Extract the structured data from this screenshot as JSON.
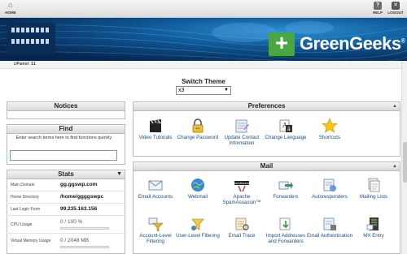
{
  "topbar": {
    "home_label": "HOME",
    "help_label": "HELP",
    "logout_label": "LOGOUT"
  },
  "brand": {
    "name": "GreenGeeks",
    "registered": "®"
  },
  "cpanel_label": "cPanel 11",
  "switch_theme": {
    "title": "Switch Theme",
    "selected": "x3"
  },
  "notices": {
    "title": "Notices"
  },
  "find": {
    "title": "Find",
    "hint": "Enter search terms here to find functions quickly.",
    "value": ""
  },
  "stats": {
    "title": "Stats",
    "rows": [
      {
        "label": "Main Domain",
        "value": "gg.ggswp.com"
      },
      {
        "label": "Home Directory",
        "value": "/home/ggggswpc"
      },
      {
        "label": "Last Login From",
        "value": "99.235.163.156"
      },
      {
        "label": "CPU Usage",
        "value": "0 / 100 %",
        "fraction": 0
      },
      {
        "label": "Virtual Memory Usage",
        "value": "0 / 2048 MB",
        "fraction": 0
      }
    ]
  },
  "preferences": {
    "title": "Preferences",
    "items": [
      {
        "label": "Video Tutorials",
        "icon": "clapperboard-icon"
      },
      {
        "label": "Change Password",
        "icon": "lock-password-icon"
      },
      {
        "label": "Update Contact Information",
        "icon": "contact-card-icon"
      },
      {
        "label": "Change Language",
        "icon": "language-icon"
      },
      {
        "label": "Shortcuts",
        "icon": "star-icon"
      }
    ]
  },
  "mail": {
    "title": "Mail",
    "items": [
      {
        "label": "Email Accounts",
        "icon": "envelope-icon"
      },
      {
        "label": "Webmail",
        "icon": "webmail-globe-icon"
      },
      {
        "label": "Apache SpamAssassin™",
        "icon": "spamassassin-icon"
      },
      {
        "label": "Forwarders",
        "icon": "forward-arrow-icon"
      },
      {
        "label": "Autoresponders",
        "icon": "autoresponder-icon"
      },
      {
        "label": "Mailing Lists",
        "icon": "mailing-list-icon"
      },
      {
        "label": "Account-Level Filtering",
        "icon": "funnel-icon"
      },
      {
        "label": "User-Level Filtering",
        "icon": "user-filter-icon"
      },
      {
        "label": "Email Trace",
        "icon": "email-trace-icon"
      },
      {
        "label": "Import Addresses and Forwarders",
        "icon": "import-icon"
      },
      {
        "label": "Email Authentication",
        "icon": "email-auth-icon"
      },
      {
        "label": "MX Entry",
        "icon": "mx-server-icon"
      }
    ]
  },
  "colors": {
    "brand_green": "#4aa642",
    "link_blue": "#1a4e8a",
    "banner_blue": "#0f5a9a"
  }
}
